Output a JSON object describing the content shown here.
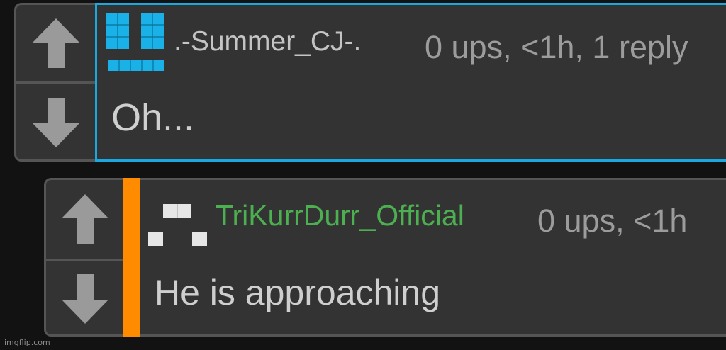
{
  "comments": [
    {
      "username": ".-Summer_CJ-.",
      "meta": "0 ups, <1h, 1 reply",
      "text": "Oh...",
      "username_color": "#c4c4c4",
      "accent_color": "#1aa8e0",
      "avatar_icon": "blue-face-icon"
    },
    {
      "username": "TriKurrDurr_Official",
      "meta": "0 ups, <1h",
      "text": "He is approaching",
      "username_color": "#4caf50",
      "accent_color": "#ff8c00",
      "avatar_icon": "white-face-icon"
    }
  ],
  "watermark": "imgflip.com",
  "vote_icons": {
    "up": "up-arrow-icon",
    "down": "down-arrow-icon"
  }
}
